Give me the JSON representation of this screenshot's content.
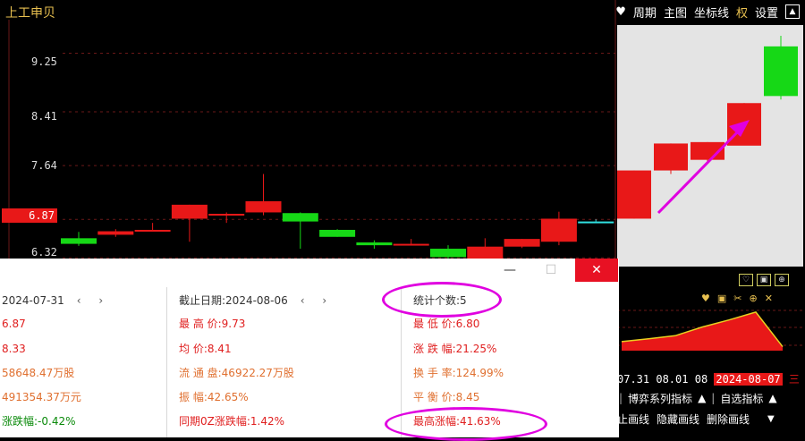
{
  "stock_title": "上工申贝",
  "toolbar": {
    "items": [
      {
        "name": "heart-icon",
        "glyph": "♥",
        "label": ""
      },
      {
        "name": "period",
        "label": "周期"
      },
      {
        "name": "main-chart",
        "label": "主图"
      },
      {
        "name": "axis-line",
        "label": "坐标线"
      },
      {
        "name": "rights",
        "label": "权",
        "highlight": true
      },
      {
        "name": "settings",
        "label": "设置"
      }
    ],
    "up_glyph": "▲"
  },
  "colors": {
    "up": "#e81818",
    "down": "#16d816",
    "grid": "#6a1818",
    "selection": "#e000e0",
    "accent": "#e8c050"
  },
  "y_labels": [
    "9.25",
    "8.41",
    "7.64",
    "6.87",
    "6.32"
  ],
  "chart_data": {
    "type": "candlestick",
    "ylim": [
      6.22,
      9.73
    ],
    "candles": [
      {
        "o": 6.6,
        "c": 6.52,
        "h": 6.69,
        "l": 6.49
      },
      {
        "o": 6.65,
        "c": 6.7,
        "h": 6.73,
        "l": 6.62
      },
      {
        "o": 6.71,
        "c": 6.72,
        "h": 6.82,
        "l": 6.7
      },
      {
        "o": 6.88,
        "c": 7.08,
        "h": 7.08,
        "l": 6.55
      },
      {
        "o": 6.94,
        "c": 6.95,
        "h": 6.97,
        "l": 6.82
      },
      {
        "o": 6.97,
        "c": 7.13,
        "h": 7.52,
        "l": 6.93
      },
      {
        "o": 6.96,
        "c": 6.84,
        "h": 6.97,
        "l": 6.45
      },
      {
        "o": 6.72,
        "c": 6.62,
        "h": 6.73,
        "l": 6.62
      },
      {
        "o": 6.54,
        "c": 6.5,
        "h": 6.57,
        "l": 6.45
      },
      {
        "o": 6.51,
        "c": 6.52,
        "h": 6.59,
        "l": 6.5
      },
      {
        "o": 6.45,
        "c": 6.33,
        "h": 6.5,
        "l": 6.3
      },
      {
        "o": 6.3,
        "c": 6.48,
        "h": 6.6,
        "l": 6.26
      },
      {
        "o": 6.48,
        "c": 6.59,
        "h": 6.59,
        "l": 6.46
      },
      {
        "o": 6.55,
        "c": 6.88,
        "h": 6.98,
        "l": 6.5
      },
      {
        "o": 6.84,
        "c": 6.84,
        "h": 6.87,
        "l": 6.84
      }
    ],
    "zoom_candles": [
      {
        "o": 6.87,
        "c": 7.55,
        "h": 7.55,
        "l": 6.87
      },
      {
        "o": 7.55,
        "c": 7.93,
        "h": 7.93,
        "l": 7.5
      },
      {
        "o": 7.7,
        "c": 7.95,
        "h": 7.95,
        "l": 7.67
      },
      {
        "o": 7.9,
        "c": 8.5,
        "h": 8.5,
        "l": 7.92
      },
      {
        "o": 8.6,
        "c": 9.3,
        "h": 9.45,
        "l": 8.55
      }
    ],
    "mini_series": [
      0.23,
      0.3,
      0.38,
      0.6,
      0.78,
      0.98,
      0.1
    ]
  },
  "mini_icons_1": [
    "♡",
    "▣",
    "⊕"
  ],
  "mini_icons_2": [
    "♥",
    "▣",
    "✂",
    "⊕",
    "✕"
  ],
  "mini_dates": {
    "d1": "07.31",
    "d2": "08.01",
    "d3": "08",
    "current": "2024-08-07",
    "weekday": "三"
  },
  "bottom_bar1": {
    "a": "博弈系列指标",
    "b": "自选指标"
  },
  "bottom_bar2": {
    "a": "止画线",
    "b": "隐藏画线",
    "c": "删除画线"
  },
  "dialog": {
    "rows": [
      {
        "c1": "2024-07-31",
        "c1_nav": "‹ ›",
        "c2": "截止日期:2024-08-06",
        "c2_nav": "‹ ›",
        "c3": "统计个数:5"
      },
      {
        "c1": "6.87",
        "c2": "最 高 价:9.73",
        "c3": "最 低 价:6.80"
      },
      {
        "c1": "8.33",
        "c2": "均    价:8.41",
        "c3": "涨 跌 幅:21.25%"
      },
      {
        "c1": "58648.47万股",
        "c2": "流 通 盘:46922.27万股",
        "c3": "换 手 率:124.99%"
      },
      {
        "c1": "491354.37万元",
        "c2": "振    幅:42.65%",
        "c3": "平 衡 价:8.45"
      },
      {
        "c1": "涨跌幅:-0.42%",
        "c2": "同期0Z涨跌幅:1.42%",
        "c3": "最高涨幅:41.63%"
      }
    ],
    "close_glyph": "✕",
    "min_glyph": "—",
    "max_glyph": "☐"
  }
}
